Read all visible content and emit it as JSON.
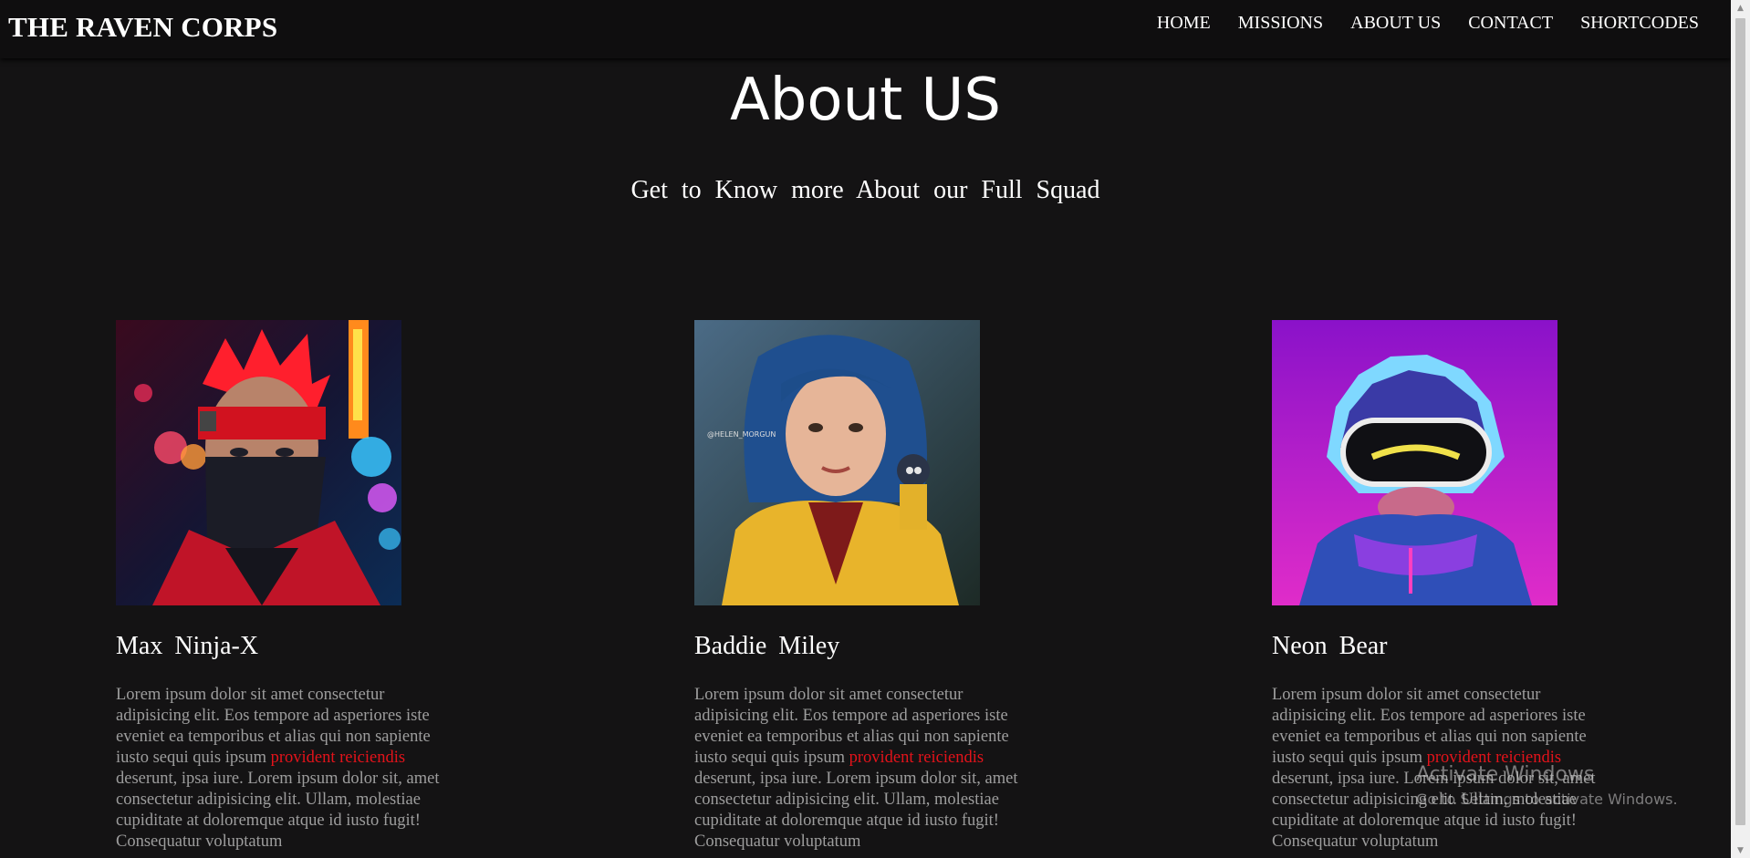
{
  "nav": {
    "brand": "THE RAVEN CORPS",
    "links": [
      "HOME",
      "MISSIONS",
      "ABOUT US",
      "CONTACT",
      "SHORTCODES"
    ]
  },
  "header": {
    "title": "About US",
    "subtitle": "Get to Know more About our Full Squad"
  },
  "members": [
    {
      "name": "Max Ninja-X",
      "photo_icon": "red-ninja-avatar",
      "bio_before": "Lorem ipsum dolor sit amet consectetur adipisicing elit. Eos tempore ad asperiores iste eveniet ea temporibus et alias qui non sapiente iusto sequi quis ipsum ",
      "bio_highlight": "provident reiciendis",
      "bio_after": " deserunt, ipsa iure. Lorem ipsum dolor sit, amet consectetur adipisicing elit. Ullam, molestiae cupiditate at doloremque atque id iusto fugit! Consequatur voluptatum"
    },
    {
      "name": "Baddie Miley",
      "photo_icon": "blue-haired-girl-avatar",
      "photo_watermark": "@HELEN_MORGUN",
      "bio_before": "Lorem ipsum dolor sit amet consectetur adipisicing elit. Eos tempore ad asperiores iste eveniet ea temporibus et alias qui non sapiente iusto sequi quis ipsum ",
      "bio_highlight": "provident reiciendis",
      "bio_after": " deserunt, ipsa iure. Lorem ipsum dolor sit, amet consectetur adipisicing elit. Ullam, molestiae cupiditate at doloremque atque id iusto fugit! Consequatur voluptatum"
    },
    {
      "name": "Neon Bear",
      "photo_icon": "neon-bear-avatar",
      "bio_before": "Lorem ipsum dolor sit amet consectetur adipisicing elit. Eos tempore ad asperiores iste eveniet ea temporibus et alias qui non sapiente iusto sequi quis ipsum ",
      "bio_highlight": "provident reiciendis",
      "bio_after": " deserunt, ipsa iure. Lorem ipsum dolor sit, amet consectetur adipisicing elit. Ullam, molestiae cupiditate at doloremque atque id iusto fugit! Consequatur voluptatum"
    }
  ],
  "watermark": {
    "title": "Activate Windows",
    "subtitle": "Go to Settings to activate Windows."
  },
  "colors": {
    "background": "#141314",
    "navbar": "#0f0e0f",
    "highlight": "#e3131a",
    "bio_text": "#9d9d9d"
  }
}
